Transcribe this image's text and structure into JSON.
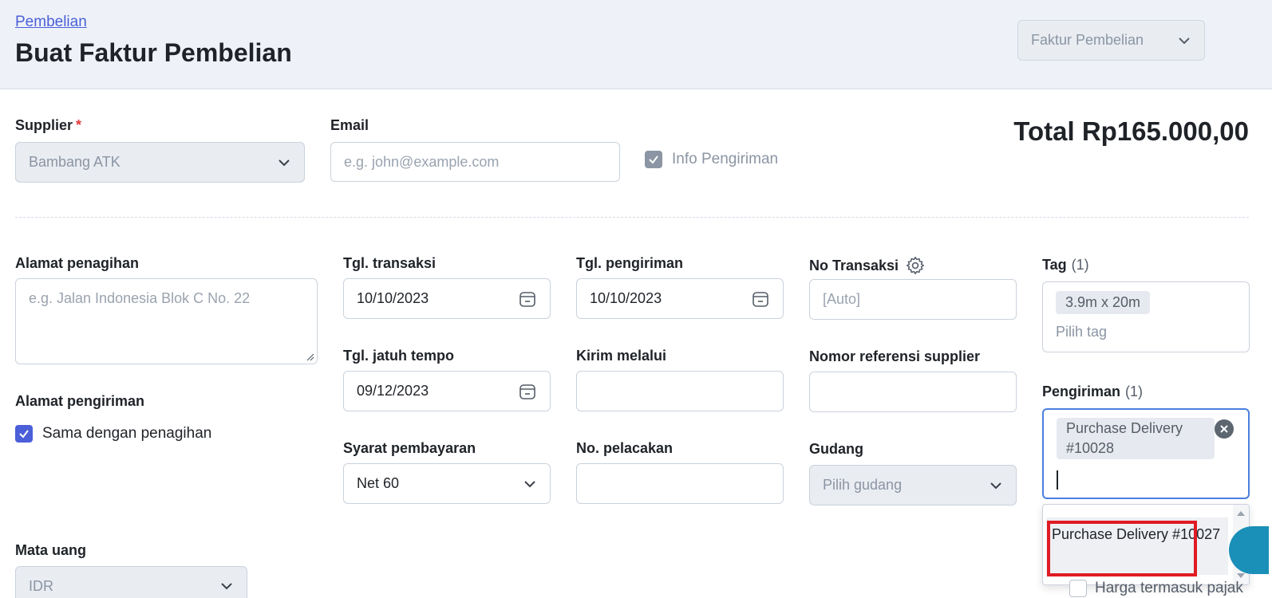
{
  "header": {
    "breadcrumb": "Pembelian",
    "title": "Buat Faktur Pembelian",
    "doc_type_select": "Faktur Pembelian"
  },
  "supplier": {
    "label": "Supplier",
    "required_mark": "*",
    "value": "Bambang ATK"
  },
  "email": {
    "label": "Email",
    "placeholder": "e.g. john@example.com"
  },
  "info_pengiriman": {
    "label": "Info Pengiriman",
    "checked": true
  },
  "total": "Total Rp165.000,00",
  "billing_address": {
    "label": "Alamat penagihan",
    "placeholder": "e.g. Jalan Indonesia Blok C No. 22"
  },
  "shipping_address": {
    "label": "Alamat pengiriman",
    "same_as_billing_label": "Sama dengan penagihan",
    "checked": true
  },
  "tgl_transaksi": {
    "label": "Tgl. transaksi",
    "value": "10/10/2023"
  },
  "tgl_pengiriman": {
    "label": "Tgl. pengiriman",
    "value": "10/10/2023"
  },
  "no_transaksi": {
    "label": "No Transaksi",
    "placeholder": "[Auto]"
  },
  "tag": {
    "label": "Tag",
    "count": "(1)",
    "chips": [
      "3.9m x 20m"
    ],
    "placeholder": "Pilih tag"
  },
  "tgl_jatuh_tempo": {
    "label": "Tgl. jatuh tempo",
    "value": "09/12/2023"
  },
  "kirim_melalui": {
    "label": "Kirim melalui",
    "value": ""
  },
  "nomor_referensi": {
    "label": "Nomor referensi supplier",
    "value": ""
  },
  "pengiriman": {
    "label": "Pengiriman",
    "count": "(1)",
    "selected": [
      "Purchase Delivery #10028"
    ],
    "options": [
      "Purchase Delivery #10027"
    ]
  },
  "syarat_pembayaran": {
    "label": "Syarat pembayaran",
    "value": "Net 60"
  },
  "no_pelacakan": {
    "label": "No. pelacakan",
    "value": ""
  },
  "gudang": {
    "label": "Gudang",
    "placeholder": "Pilih gudang"
  },
  "mata_uang": {
    "label": "Mata uang",
    "value": "IDR"
  },
  "harga_termasuk_pajak": {
    "label": "Harga termasuk pajak",
    "checked": false
  },
  "colors": {
    "accent": "#4a5fd8",
    "focus": "#4a7fe0",
    "highlight": "#e01b24",
    "fab": "#1a8fb8"
  }
}
